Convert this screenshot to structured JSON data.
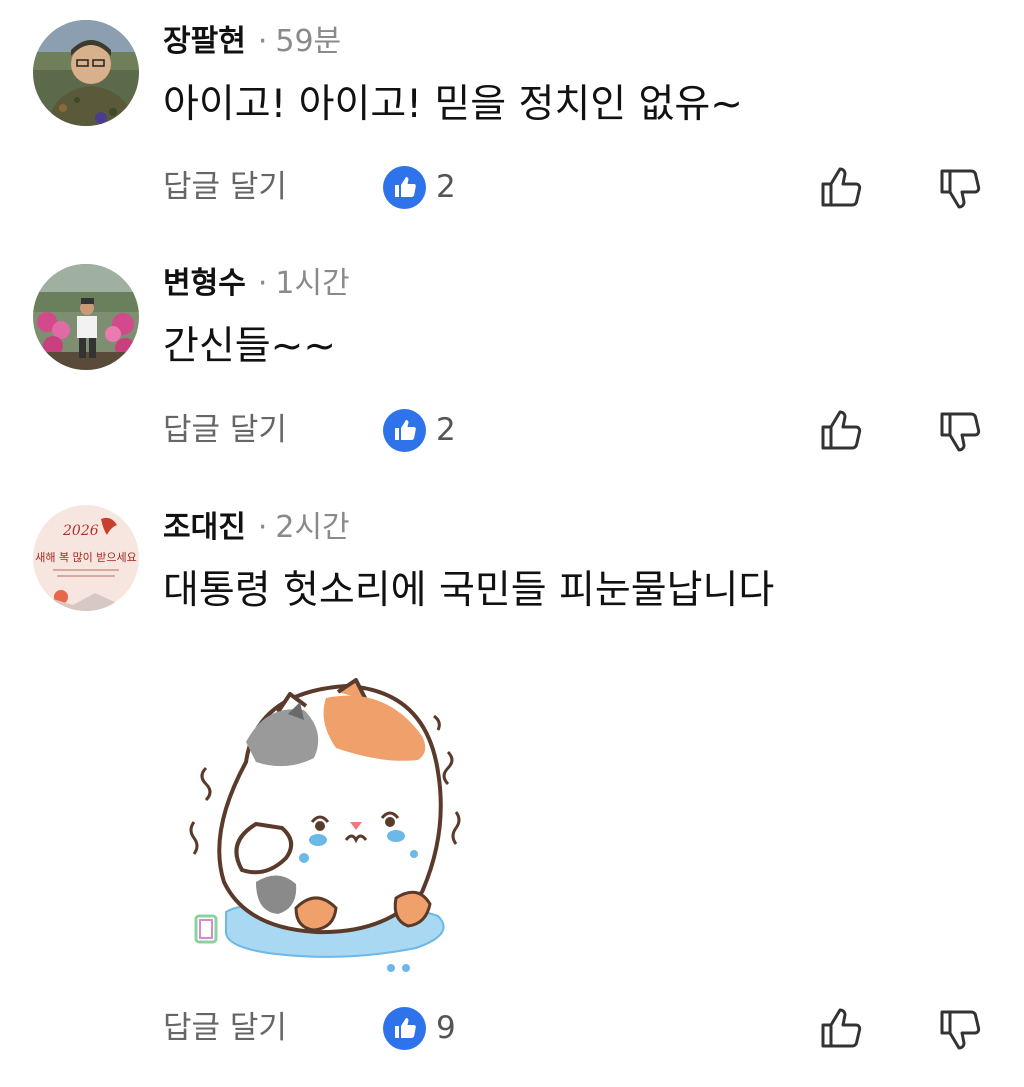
{
  "colors": {
    "like_blue": "#2e73ea",
    "meta_gray": "#8a8a8a",
    "action_gray": "#666666"
  },
  "comments": [
    {
      "author": "장팔현",
      "separator": "·",
      "time": "59분",
      "text": "아이고! 아이고! 믿을 정치인 없유~",
      "reply_label": "답글 달기",
      "reaction_icon": "thumbs-up-icon",
      "like_count": "2",
      "avatar": "avatar-photo-soldier"
    },
    {
      "author": "변형수",
      "separator": "·",
      "time": "1시간",
      "text": "간신들~~",
      "reply_label": "답글 달기",
      "reaction_icon": "thumbs-up-icon",
      "like_count": "2",
      "avatar": "avatar-photo-garden"
    },
    {
      "author": "조대진",
      "separator": "·",
      "time": "2시간",
      "text": "대통령 헛소리에 국민들 피눈물납니다",
      "reply_label": "답글 달기",
      "reaction_icon": "thumbs-up-icon",
      "like_count": "9",
      "avatar": "avatar-new-year-card",
      "sticker": "crying-cat-sticker"
    }
  ],
  "avatar_text": {
    "year": "2026",
    "greeting": "새해 복 많이 받으세요"
  }
}
